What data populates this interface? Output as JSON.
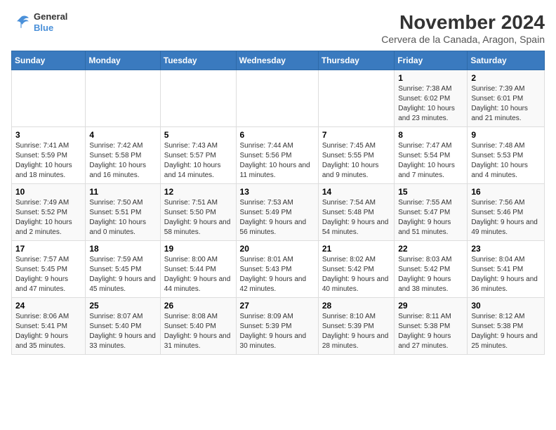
{
  "logo": {
    "line1": "General",
    "line2": "Blue"
  },
  "title": "November 2024",
  "location": "Cervera de la Canada, Aragon, Spain",
  "days_of_week": [
    "Sunday",
    "Monday",
    "Tuesday",
    "Wednesday",
    "Thursday",
    "Friday",
    "Saturday"
  ],
  "weeks": [
    [
      {
        "day": "",
        "info": ""
      },
      {
        "day": "",
        "info": ""
      },
      {
        "day": "",
        "info": ""
      },
      {
        "day": "",
        "info": ""
      },
      {
        "day": "",
        "info": ""
      },
      {
        "day": "1",
        "info": "Sunrise: 7:38 AM\nSunset: 6:02 PM\nDaylight: 10 hours and 23 minutes."
      },
      {
        "day": "2",
        "info": "Sunrise: 7:39 AM\nSunset: 6:01 PM\nDaylight: 10 hours and 21 minutes."
      }
    ],
    [
      {
        "day": "3",
        "info": "Sunrise: 7:41 AM\nSunset: 5:59 PM\nDaylight: 10 hours and 18 minutes."
      },
      {
        "day": "4",
        "info": "Sunrise: 7:42 AM\nSunset: 5:58 PM\nDaylight: 10 hours and 16 minutes."
      },
      {
        "day": "5",
        "info": "Sunrise: 7:43 AM\nSunset: 5:57 PM\nDaylight: 10 hours and 14 minutes."
      },
      {
        "day": "6",
        "info": "Sunrise: 7:44 AM\nSunset: 5:56 PM\nDaylight: 10 hours and 11 minutes."
      },
      {
        "day": "7",
        "info": "Sunrise: 7:45 AM\nSunset: 5:55 PM\nDaylight: 10 hours and 9 minutes."
      },
      {
        "day": "8",
        "info": "Sunrise: 7:47 AM\nSunset: 5:54 PM\nDaylight: 10 hours and 7 minutes."
      },
      {
        "day": "9",
        "info": "Sunrise: 7:48 AM\nSunset: 5:53 PM\nDaylight: 10 hours and 4 minutes."
      }
    ],
    [
      {
        "day": "10",
        "info": "Sunrise: 7:49 AM\nSunset: 5:52 PM\nDaylight: 10 hours and 2 minutes."
      },
      {
        "day": "11",
        "info": "Sunrise: 7:50 AM\nSunset: 5:51 PM\nDaylight: 10 hours and 0 minutes."
      },
      {
        "day": "12",
        "info": "Sunrise: 7:51 AM\nSunset: 5:50 PM\nDaylight: 9 hours and 58 minutes."
      },
      {
        "day": "13",
        "info": "Sunrise: 7:53 AM\nSunset: 5:49 PM\nDaylight: 9 hours and 56 minutes."
      },
      {
        "day": "14",
        "info": "Sunrise: 7:54 AM\nSunset: 5:48 PM\nDaylight: 9 hours and 54 minutes."
      },
      {
        "day": "15",
        "info": "Sunrise: 7:55 AM\nSunset: 5:47 PM\nDaylight: 9 hours and 51 minutes."
      },
      {
        "day": "16",
        "info": "Sunrise: 7:56 AM\nSunset: 5:46 PM\nDaylight: 9 hours and 49 minutes."
      }
    ],
    [
      {
        "day": "17",
        "info": "Sunrise: 7:57 AM\nSunset: 5:45 PM\nDaylight: 9 hours and 47 minutes."
      },
      {
        "day": "18",
        "info": "Sunrise: 7:59 AM\nSunset: 5:45 PM\nDaylight: 9 hours and 45 minutes."
      },
      {
        "day": "19",
        "info": "Sunrise: 8:00 AM\nSunset: 5:44 PM\nDaylight: 9 hours and 44 minutes."
      },
      {
        "day": "20",
        "info": "Sunrise: 8:01 AM\nSunset: 5:43 PM\nDaylight: 9 hours and 42 minutes."
      },
      {
        "day": "21",
        "info": "Sunrise: 8:02 AM\nSunset: 5:42 PM\nDaylight: 9 hours and 40 minutes."
      },
      {
        "day": "22",
        "info": "Sunrise: 8:03 AM\nSunset: 5:42 PM\nDaylight: 9 hours and 38 minutes."
      },
      {
        "day": "23",
        "info": "Sunrise: 8:04 AM\nSunset: 5:41 PM\nDaylight: 9 hours and 36 minutes."
      }
    ],
    [
      {
        "day": "24",
        "info": "Sunrise: 8:06 AM\nSunset: 5:41 PM\nDaylight: 9 hours and 35 minutes."
      },
      {
        "day": "25",
        "info": "Sunrise: 8:07 AM\nSunset: 5:40 PM\nDaylight: 9 hours and 33 minutes."
      },
      {
        "day": "26",
        "info": "Sunrise: 8:08 AM\nSunset: 5:40 PM\nDaylight: 9 hours and 31 minutes."
      },
      {
        "day": "27",
        "info": "Sunrise: 8:09 AM\nSunset: 5:39 PM\nDaylight: 9 hours and 30 minutes."
      },
      {
        "day": "28",
        "info": "Sunrise: 8:10 AM\nSunset: 5:39 PM\nDaylight: 9 hours and 28 minutes."
      },
      {
        "day": "29",
        "info": "Sunrise: 8:11 AM\nSunset: 5:38 PM\nDaylight: 9 hours and 27 minutes."
      },
      {
        "day": "30",
        "info": "Sunrise: 8:12 AM\nSunset: 5:38 PM\nDaylight: 9 hours and 25 minutes."
      }
    ]
  ]
}
